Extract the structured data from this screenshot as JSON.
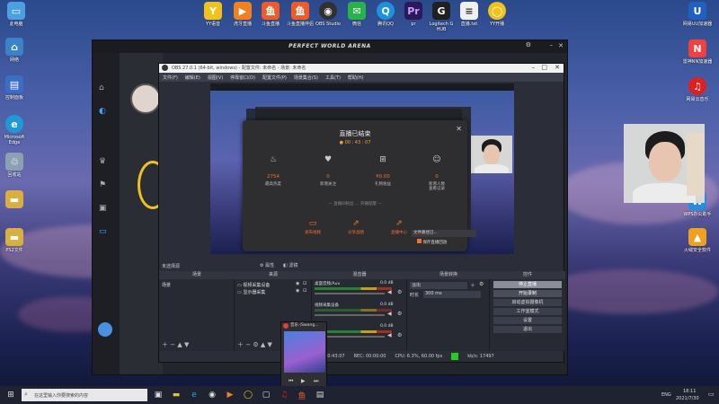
{
  "desktop_left_icons": [
    {
      "label": "此电脑",
      "icon": "computer-icon",
      "color": "#4aa0e0"
    },
    {
      "label": "网络",
      "icon": "network-icon",
      "color": "#3c82c8"
    },
    {
      "label": "控制面板",
      "icon": "control-panel-icon",
      "color": "#3c6ec8"
    },
    {
      "label": "Microsoft Edge",
      "icon": "edge-icon",
      "color": "#1f9ad6"
    },
    {
      "label": "回收站",
      "icon": "recycle-bin-icon",
      "color": "#8ca0b4"
    },
    {
      "label": "",
      "icon": "folder-icon",
      "color": "#d8b040"
    },
    {
      "label": "PS2文件",
      "icon": "folder-icon",
      "color": "#d8b040"
    }
  ],
  "desktop_top_icons": [
    {
      "label": "YY语音",
      "icon": "yy-icon",
      "color": "#f2c21a"
    },
    {
      "label": "虎牙直播",
      "icon": "huya-icon",
      "color": "#f08020"
    },
    {
      "label": "斗鱼直播",
      "icon": "douyu-icon",
      "color": "#f05a28"
    },
    {
      "label": "斗鱼直播伴侣",
      "icon": "douyu-assistant-icon",
      "color": "#f05a28"
    },
    {
      "label": "OBS Studio",
      "icon": "obs-icon",
      "color": "#303030"
    },
    {
      "label": "微信",
      "icon": "wechat-icon",
      "color": "#2ab24a"
    },
    {
      "label": "腾讯QQ",
      "icon": "qq-icon",
      "color": "#1e90e0"
    },
    {
      "label": "pr",
      "icon": "premiere-icon",
      "color": "#2a1a5a"
    },
    {
      "label": "Logitech G HUB",
      "icon": "logitech-icon",
      "color": "#202020"
    },
    {
      "label": "直播.txt",
      "icon": "text-file-icon",
      "color": "#f0f0f0"
    },
    {
      "label": "YY开播",
      "icon": "yy-live-icon",
      "color": "#f2c21a"
    }
  ],
  "desktop_right_icons": [
    {
      "label": "网易UU加速器",
      "icon": "uu-icon",
      "color": "#2060c0"
    },
    {
      "label": "雷神NN加速器",
      "icon": "leishen-icon",
      "color": "#f04040"
    },
    {
      "label": "网易云音乐",
      "icon": "netease-music-icon",
      "color": "#e02020"
    },
    {
      "label": "WPS办公助手",
      "icon": "wps-icon",
      "color": "#2a8ae0"
    },
    {
      "label": "火绒安全软件",
      "icon": "huorong-icon",
      "color": "#f0a020"
    }
  ],
  "pwa_window": {
    "title": "PERFECT WORLD ARENA"
  },
  "obs": {
    "title": "OBS 27.0.1 (64-bit, windows) - 配置文件: 未命名 - 场景: 未命名",
    "menu": [
      "文件(F)",
      "编辑(E)",
      "视图(V)",
      "停靠窗口(D)",
      "配置文件(P)",
      "场景集合(S)",
      "工具(T)",
      "帮助(H)"
    ],
    "no_source_selected": "未选择源",
    "properties_label": "属性",
    "filters_label": "滤镜",
    "dock_titles": [
      "场景",
      "来源",
      "混音器",
      "场景转换",
      "控件"
    ],
    "scene_item": "场景",
    "sources": [
      "视频采集设备",
      "显示器采集"
    ],
    "mixer_channels": [
      "桌面音频/Aux",
      "视频采集设备",
      "麦克风"
    ],
    "mixer_db": [
      "0.0 dB",
      "0.0 dB",
      "0.0 dB"
    ],
    "transition": "淡出",
    "duration_label": "时长",
    "duration_value": "300 ms",
    "controls": [
      "停止直播",
      "开始录制",
      "启动虚拟摄像机",
      "工作室模式",
      "设置",
      "退出"
    ],
    "status": [
      "LIVE: 00:43:07",
      "REC: 00:00:00",
      "CPU: 6.3%, 60.00 fps",
      "kb/s: 17497"
    ]
  },
  "dialog": {
    "title": "直播已结束",
    "duration": "00 : 43 : 07",
    "stats": [
      {
        "value": "2754",
        "label": "最高热度",
        "icon": "flame-icon"
      },
      {
        "value": "0",
        "label": "新增关注",
        "icon": "heart-plus-icon"
      },
      {
        "value": "¥0.00",
        "label": "礼物收益",
        "icon": "gift-icon"
      },
      {
        "value": "0",
        "label": "新增人数\n查看记录",
        "icon": "user-icon"
      }
    ],
    "notice": "直播间粉丝 ... 开播提醒",
    "actions": [
      {
        "label": "发布视频",
        "icon": "video-icon"
      },
      {
        "label": "分享战绩",
        "icon": "share-icon"
      },
      {
        "label": "直播中心",
        "icon": "center-icon"
      }
    ],
    "save_option": "保存直播回放",
    "footer_hint": "文件路径已..."
  },
  "player": {
    "title": "音乐 (Swang..."
  },
  "taskbar": {
    "search_placeholder": "在这里输入你要搜索的内容",
    "tray_lang": "ENG",
    "time": "18:11",
    "date": "2021/7/30"
  },
  "colors": {
    "accent": "#f07030",
    "obs_bg": "#2b2e38",
    "live_green": "#1fd01f"
  }
}
